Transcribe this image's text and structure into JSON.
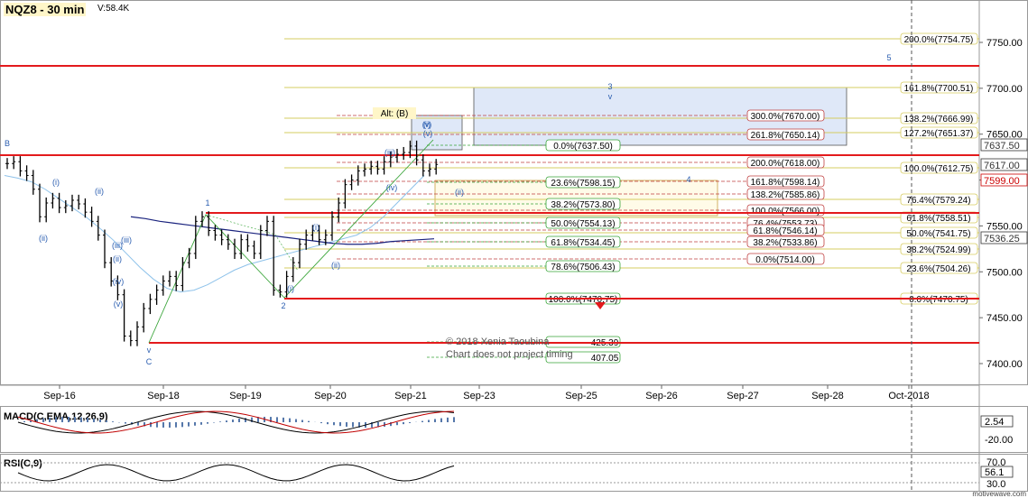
{
  "header": {
    "symbol": "NQZ8 - 30 min",
    "volume": "V:58.4K"
  },
  "footer": {
    "brand": "motivewave.com"
  },
  "chart_data": {
    "type": "candlestick",
    "price_axis": {
      "ticks": [
        "7750.00",
        "7700.00",
        "7650.00",
        "7600.00",
        "7550.00",
        "7500.00",
        "7450.00",
        "7400.00"
      ]
    },
    "price_badges": [
      {
        "label": "7637.50",
        "color": "#333333"
      },
      {
        "label": "7617.00",
        "color": "#333333"
      },
      {
        "label": "7599.00",
        "color": "#cc0000"
      },
      {
        "label": "7536.25",
        "color": "#333333"
      }
    ],
    "time_axis": [
      "Sep-16",
      "Sep-18",
      "Sep-19",
      "Sep-20",
      "Sep-21",
      "Sep-23",
      "Sep-25",
      "Sep-26",
      "Sep-27",
      "Sep-28",
      "Oct-2018"
    ],
    "series": [
      {
        "kind": "ohlc",
        "close": [
          7618,
          7620,
          7610,
          7605,
          7590,
          7560,
          7575,
          7580,
          7570,
          7572,
          7578,
          7574,
          7565,
          7555,
          7540,
          7510,
          7490,
          7475,
          7430,
          7425,
          7440,
          7460,
          7470,
          7480,
          7490,
          7495,
          7485,
          7510,
          7520,
          7555,
          7560,
          7545,
          7540,
          7535,
          7530,
          7520,
          7535,
          7528,
          7520,
          7545,
          7555,
          7480,
          7478,
          7495,
          7510,
          7530,
          7540,
          7545,
          7535,
          7540,
          7560,
          7575,
          7595,
          7600,
          7610,
          7612,
          7615,
          7612,
          7620,
          7625,
          7628,
          7630,
          7637,
          7622,
          7610,
          7612,
          7617
        ]
      },
      {
        "kind": "moving-average",
        "color": "#8ec2ea",
        "values": [
          7605,
          7602,
          7598,
          7590,
          7580,
          7570,
          7560,
          7548,
          7535,
          7520,
          7505,
          7492,
          7482,
          7478,
          7480,
          7486,
          7494,
          7502,
          7508,
          7512,
          7516,
          7520,
          7524,
          7528,
          7532,
          7536,
          7540,
          7548,
          7560,
          7575,
          7590,
          7605
        ]
      },
      {
        "kind": "moving-average",
        "color": "#1a237e",
        "values": [
          7560,
          7558,
          7555,
          7553,
          7551,
          7549,
          7547,
          7545,
          7543,
          7541,
          7539,
          7537,
          7535,
          7533,
          7531,
          7530,
          7530,
          7531,
          7533,
          7534,
          7535,
          7536
        ]
      }
    ],
    "horizontal_levels": [
      7722,
      7617,
      7566,
      7470.75,
      7420
    ],
    "fib_right": [
      "200.0%(7754.75)",
      "161.8%(7700.51)",
      "138.2%(7666.99)",
      "127.2%(7651.37)",
      "100.0%(7612.75)",
      "76.4%(7579.24)",
      "61.8%(7558.51)",
      "50.0%(7541.75)",
      "38.2%(7524.99)",
      "23.6%(7504.26)",
      "0.0%(7470.75)"
    ],
    "fib_green": [
      "0.0%(7637.50)",
      "23.6%(7598.15)",
      "38.2%(7573.80)",
      "50.0%(7554.13)",
      "61.8%(7534.45)",
      "78.6%(7506.43)",
      "100.0%(7470.75)"
    ],
    "fib_red": [
      "300.0%(7670.00)",
      "261.8%(7650.14)",
      "200.0%(7618.00)",
      "161.8%(7598.14)",
      "138.2%(7585.86)",
      "100.0%(7566.00)",
      "76.4%(7553.73)",
      "61.8%(7546.14)",
      "38.2%(7533.86)",
      "0.0%(7514.00)"
    ],
    "fib_lower": [
      "425.39",
      "407.05"
    ],
    "wave_labels": [
      "B",
      "(i)",
      "(ii)",
      "(ii)",
      "(iii)",
      "(iv)",
      "(v)",
      "(i)",
      "(ii)",
      "(iii)",
      "(iv)",
      "(v)",
      "(i)",
      "(ii)",
      "(iii)",
      "(iv)",
      "(v)",
      "v",
      "C",
      "1",
      "2",
      "(iii)",
      "3",
      "v",
      "4",
      "5",
      "Alt: (B)",
      "(ii)",
      "(i)",
      "(v)"
    ],
    "notes": [
      "© 2018 Xenia Taoubina",
      "Chart does not project timing"
    ],
    "macd": {
      "label": "MACD(C,EMA,12,26,9)",
      "ticks": [
        "2.54",
        "-20.00"
      ]
    },
    "rsi": {
      "label": "RSI(C,9)",
      "ticks": [
        "70.0",
        "56.1",
        "30.0"
      ]
    },
    "colors": {
      "red_line": "#e31a1c",
      "fib_gold": "#d6cc60",
      "green": "#3aa53a",
      "wave": "#2a5db0",
      "box": "#dfe8f8"
    }
  }
}
